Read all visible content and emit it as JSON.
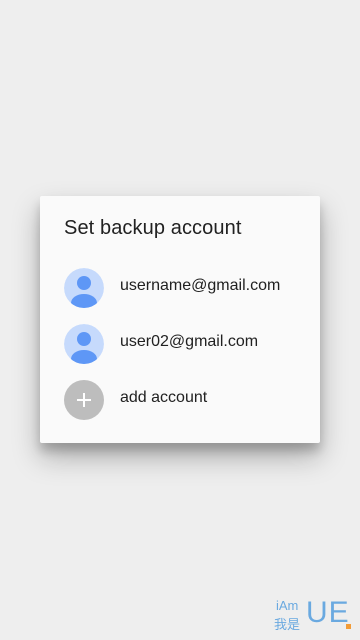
{
  "dialog": {
    "title": "Set backup account",
    "accounts": [
      {
        "label": "username@gmail.com",
        "icon": "account-avatar-icon"
      },
      {
        "label": "user02@gmail.com",
        "icon": "account-avatar-icon"
      }
    ],
    "add_account": {
      "label": "add account",
      "icon": "plus-icon"
    }
  },
  "watermark": {
    "line1": "iAm",
    "line2": "我是",
    "brand": "UE"
  },
  "colors": {
    "background": "#eeeeee",
    "dialog": "#fafafa",
    "avatar_bg": "#c6dafc",
    "avatar_figure": "#5e97f6",
    "add_circle": "#bdbdbd",
    "text_primary": "#212121",
    "watermark_blue": "#6aa9e0",
    "watermark_orange": "#f29c38"
  }
}
